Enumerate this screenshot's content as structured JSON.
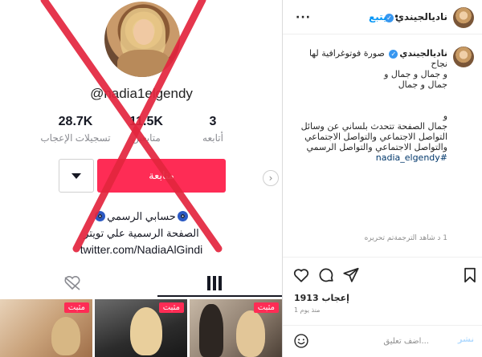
{
  "media": {
    "tiktok_handle": "@nadia1elgendy",
    "stats": {
      "likes": {
        "value": "28.7K",
        "label": "تسجيلات الإعجاب"
      },
      "followers": {
        "value": "11.5K",
        "label": "متابعين"
      },
      "following": {
        "value": "3",
        "label": "أتابعه"
      }
    },
    "follow_label": "متابعة",
    "bio": {
      "official": "حسابي الرسمي",
      "page": "الصفحة الرسمية علي تويتر",
      "twitter": "twitter.com/NadiaAlGindi"
    },
    "pinned_label": "مثبت",
    "colors": {
      "tiktok_red": "#fe2c55",
      "cross_red": "#e3263e"
    }
  },
  "post": {
    "username": "ناديالجيندي",
    "follow_label": "يتبع",
    "more_icon": "more-horizontal-icon",
    "caption": {
      "username": "ناديالجيندي",
      "lines": [
        "صورة فوتوغرافية لها نجاح",
        "و جمال و جمال و",
        "جمال و جمال",
        "",
        "و",
        "جمال الصفحة تتحدث بلساني عن وسائل",
        "التواصل الاجتماعي والتواصل الاجتماعي",
        "والتواصل الاجتماعي والتواصل الرسمي"
      ],
      "hashtag": "#nadia_elgendy"
    },
    "meta": "1 د  شاهد الترجمةتم تحريره",
    "likes": "إعجاب 1913",
    "time": "منذ يوم 1",
    "comment_placeholder": "...اضف تعليق",
    "post_label": "نشر"
  },
  "colors": {
    "link_blue": "#0095f6",
    "verified_blue": "#3897f0",
    "hashtag_blue": "#00376b"
  }
}
